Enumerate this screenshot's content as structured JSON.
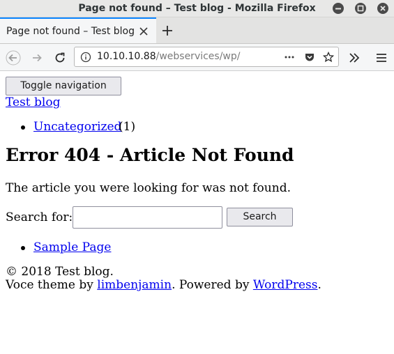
{
  "window": {
    "title": "Page not found – Test blog - Mozilla Firefox"
  },
  "tabs": [
    {
      "label": "Page not found – Test blog"
    }
  ],
  "urlbar": {
    "host": "10.10.10.88",
    "path": "/webservices/wp/"
  },
  "page": {
    "toggle_nav_label": "Toggle navigation",
    "site_title": "Test blog",
    "categories": [
      {
        "label": "Uncategorized",
        "count": "(1)"
      }
    ],
    "heading": "Error 404 - Article Not Found",
    "message": "The article you were looking for was not found.",
    "search": {
      "label": "Search for:",
      "value": "",
      "button_label": "Search"
    },
    "pages": [
      {
        "label": "Sample Page"
      }
    ],
    "footer": {
      "copyright": "© 2018 Test blog.",
      "credit_prefix": "Voce theme by ",
      "theme_author": "limbenjamin",
      "credit_middle": ". Powered by ",
      "platform": "WordPress",
      "credit_suffix": "."
    }
  },
  "icons": {
    "window_buttons": [
      "minimize-icon",
      "maximize-icon",
      "close-icon"
    ],
    "nav": [
      "back-icon",
      "forward-icon",
      "reload-icon",
      "site-info-icon",
      "page-actions-icon",
      "pocket-icon",
      "bookmark-star-icon",
      "overflow-icon",
      "hamburger-menu-icon"
    ]
  }
}
